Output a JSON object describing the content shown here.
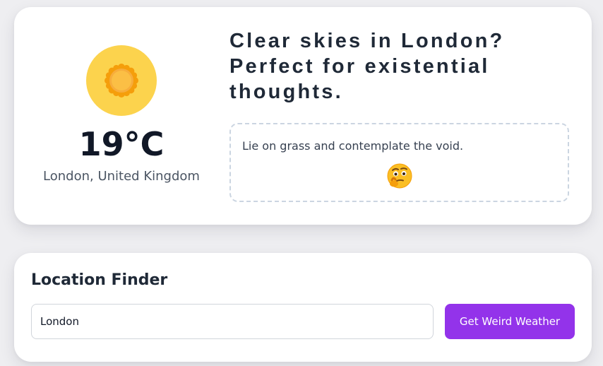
{
  "weather": {
    "icon": "sun-icon",
    "temperature": "19°C",
    "location": "London, United Kingdom",
    "headline": "Clear skies in London? Perfect for existential thoughts.",
    "suggestion": "Lie on grass and contemplate the void.",
    "suggestion_icon": "thinking-face-icon"
  },
  "finder": {
    "title": "Location Finder",
    "input_value": "London",
    "button_label": "Get Weird Weather"
  },
  "colors": {
    "accent": "#9333ea",
    "sun_background": "#fcd34d"
  }
}
